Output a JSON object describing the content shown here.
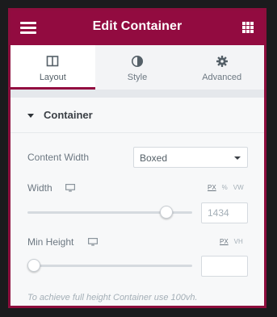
{
  "header": {
    "title": "Edit Container",
    "menu_icon": "hamburger-menu-icon",
    "apps_icon": "grid-apps-icon",
    "background_color": "#920b40"
  },
  "tabs": [
    {
      "label": "Layout",
      "icon": "layout-columns-icon",
      "active": true
    },
    {
      "label": "Style",
      "icon": "half-circle-style-icon",
      "active": false
    },
    {
      "label": "Advanced",
      "icon": "gear-icon",
      "active": false
    }
  ],
  "section": {
    "title": "Container",
    "expanded": true
  },
  "controls": {
    "content_width": {
      "label": "Content Width",
      "value": "Boxed"
    },
    "width": {
      "label": "Width",
      "device_icon": "desktop-monitor-icon",
      "units": [
        "PX",
        "%",
        "VW"
      ],
      "selected_unit": "PX",
      "value": "1434",
      "slider_fraction": 0.87
    },
    "min_height": {
      "label": "Min Height",
      "device_icon": "desktop-monitor-icon",
      "units": [
        "PX",
        "VH"
      ],
      "selected_unit": "PX",
      "value": "",
      "slider_fraction": 0.0
    }
  },
  "hint": "To achieve full height Container use 100vh."
}
